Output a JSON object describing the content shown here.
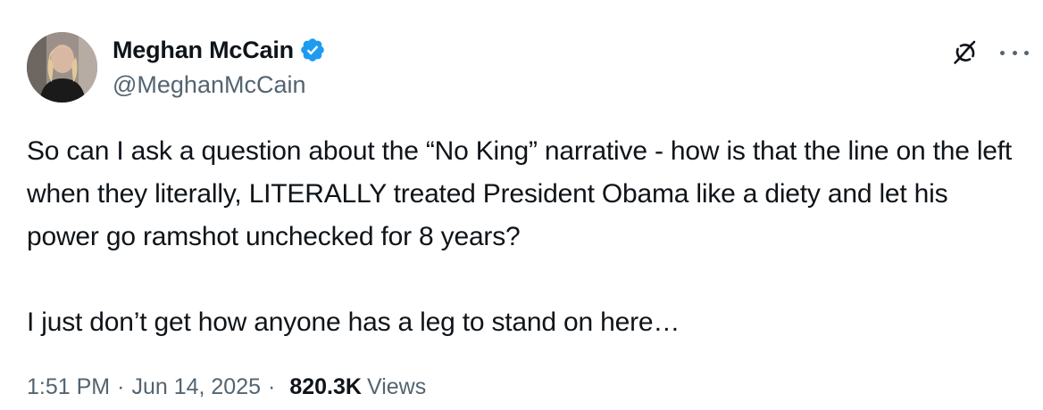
{
  "author": {
    "name": "Meghan McCain",
    "handle": "@MeghanMcCain",
    "verified_color": "#1d9bf0"
  },
  "icons": {
    "verified": "verified-badge-icon",
    "grok": "grok-icon",
    "more": "more-options-icon"
  },
  "tweet": {
    "paragraph1": "So can I ask a question about the “No King” narrative - how is that the line on the left when they literally, LITERALLY treated President Obama like a diety and let his power go ramshot unchecked for 8 years?",
    "paragraph2": "I just don’t get how anyone has a leg to stand on here…"
  },
  "meta": {
    "time": "1:51 PM",
    "separator1": "·",
    "date": "Jun 14, 2025",
    "separator2": "·",
    "views_count": "820.3K",
    "views_label": "Views"
  }
}
